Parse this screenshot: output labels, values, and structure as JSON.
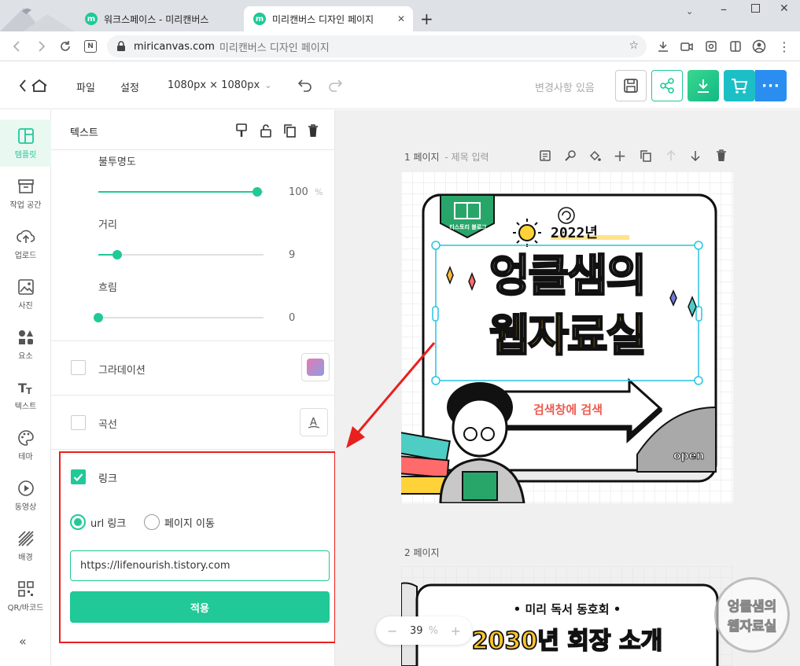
{
  "browser": {
    "tabs": [
      {
        "title": "워크스페이스 - 미리캔버스"
      },
      {
        "title": "미리캔버스 디자인 페이지"
      }
    ],
    "favicon_letter": "m",
    "url_host": "miricanvas.com",
    "url_title": "미리캔버스 디자인 페이지",
    "accent": "#20c997"
  },
  "header": {
    "menu_file": "파일",
    "menu_settings": "설정",
    "size_label": "1080px × 1080px",
    "save_status": "변경사항 있음"
  },
  "rail": {
    "items": [
      {
        "label": "템플릿",
        "icon": "template-icon"
      },
      {
        "label": "작업 공간",
        "icon": "workspace-icon"
      },
      {
        "label": "업로드",
        "icon": "upload-icon"
      },
      {
        "label": "사진",
        "icon": "photo-icon"
      },
      {
        "label": "요소",
        "icon": "elements-icon"
      },
      {
        "label": "텍스트",
        "icon": "text-icon"
      },
      {
        "label": "테마",
        "icon": "theme-icon"
      },
      {
        "label": "동영상",
        "icon": "video-icon"
      },
      {
        "label": "배경",
        "icon": "background-icon"
      },
      {
        "label": "QR/바코드",
        "icon": "qr-icon"
      }
    ]
  },
  "panel": {
    "title": "텍스트",
    "opacity": {
      "label": "불투명도",
      "value": "100",
      "unit": "%",
      "fraction": 1.0
    },
    "distance": {
      "label": "거리",
      "value": "9",
      "fraction": 0.12
    },
    "blur": {
      "label": "흐림",
      "value": "0",
      "fraction": 0.0
    },
    "gradient_label": "그라데이션",
    "curve_label": "곡선",
    "link": {
      "label": "링크",
      "checked": true,
      "option_url": "url 링크",
      "option_page": "페이지 이동",
      "url_value": "https://lifenourish.tistory.com",
      "apply_label": "적용"
    }
  },
  "canvas": {
    "page1_label": "1 페이지",
    "page1_title_placeholder": "- 제목 입력",
    "page2_label": "2 페이지",
    "design1": {
      "badge": "티스토리 블로그",
      "year": "2022년",
      "title_line1": "엉클샘의",
      "title_line2": "웹자료실",
      "arrow_text": "검색창에 검색",
      "open": "open"
    },
    "design2": {
      "subtitle": "• 미리 독서 동호회 •",
      "title": "2030년 회장 소개"
    },
    "zoom": "39",
    "zoom_unit": "%"
  },
  "watermark": {
    "line1": "엉클샘의",
    "line2": "웹자료실"
  }
}
